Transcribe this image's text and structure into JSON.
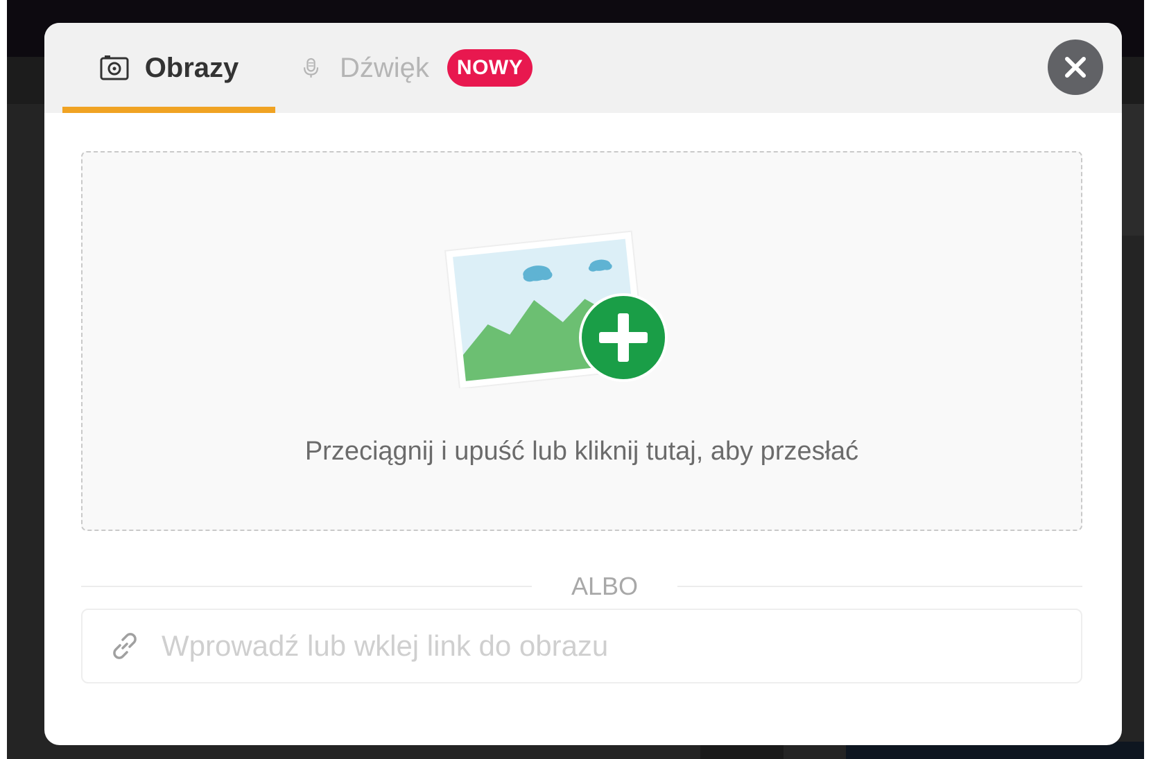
{
  "tabs": {
    "images": {
      "label": "Obrazy",
      "icon": "camera-icon",
      "active": true
    },
    "audio": {
      "label": "Dźwięk",
      "icon": "microphone-icon",
      "badge": "NOWY",
      "active": false
    }
  },
  "close_button": {
    "icon": "close-icon"
  },
  "dropzone": {
    "icon": "image-add-icon",
    "text": "Przeciągnij i upuść lub kliknij tutaj, aby przesłać"
  },
  "divider": {
    "text": "ALBO"
  },
  "url_input": {
    "icon": "link-icon",
    "placeholder": "Wprowadź lub wklej link do obrazu",
    "value": ""
  },
  "colors": {
    "accent_underline": "#f0a323",
    "badge": "#e8184f",
    "add_button": "#1a9e47",
    "mountains": "#6cbf72",
    "sky": "#dceff7",
    "clouds": "#5fb3d3"
  }
}
